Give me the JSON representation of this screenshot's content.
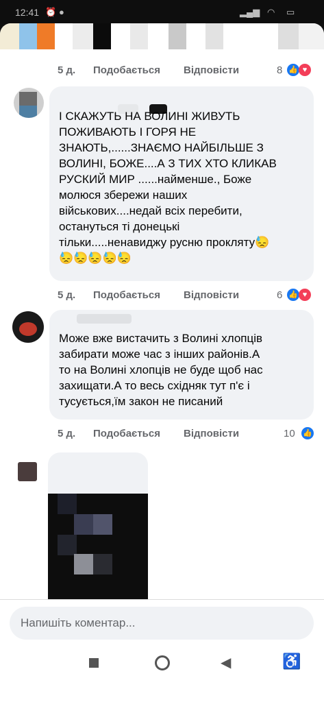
{
  "status": {
    "time": "12:41"
  },
  "comments": [
    {
      "text": "",
      "time": "5 д.",
      "like": "Подобається",
      "reply": "Відповісти",
      "count": "8",
      "reactions": [
        "like",
        "love"
      ]
    },
    {
      "text": "І СКАЖУТЬ НА ВОЛИНІ ЖИВУТЬ\nПОЖИВАЮТЬ І ГОРЯ НЕ\nЗНАЮТЬ,......ЗНАЄМО НАЙБІЛЬШЕ З\nВОЛИНІ, БОЖЕ....А З ТИХ ХТО КЛИКАВ\nРУСКИЙ МИР ......найменше., Боже\nмолюся збережи наших\nвійськових....недай всіх перебити,\nостануться ті донецькі\nтільки.....ненавиджу русню прокляту😓\n😓😓😓😓😓",
      "time": "5 д.",
      "like": "Подобається",
      "reply": "Відповісти",
      "count": "6",
      "reactions": [
        "like",
        "love"
      ]
    },
    {
      "text": "Може вже вистачить з Волині хлопців\nзабирати може час  з інших районів.А\nто на Волині хлопців не буде щоб нас\nзахищати.А то весь східняк тут п'є і\nтусується,їм закон не писаний",
      "time": "5 д.",
      "like": "Подобається",
      "reply": "Відповісти",
      "count": "10",
      "reactions": [
        "like"
      ]
    }
  ],
  "composer": {
    "placeholder": "Напишіть коментар..."
  },
  "colors": {
    "like": "#1877f2",
    "love": "#f33e58",
    "bubble": "#f0f2f5"
  },
  "icons": [
    "square-nav-icon",
    "circle-nav-icon",
    "back-nav-icon",
    "accessibility-icon"
  ]
}
